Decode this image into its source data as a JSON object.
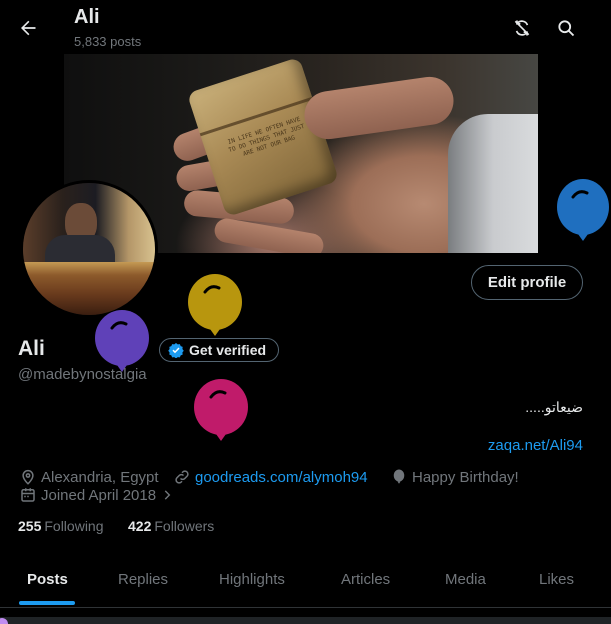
{
  "header": {
    "title": "Ali",
    "post_count": "5,833 posts",
    "back_icon": "arrow-left-icon",
    "actions": [
      "sync-off-icon",
      "search-icon"
    ]
  },
  "banner": {
    "lighter_engraving": "IN LIFE WE OFTEN HAVE TO DO THINGS THAT JUST ARE NOT OUR BAG"
  },
  "profile": {
    "name": "Ali",
    "handle": "@madebynostalgia",
    "verified_label": "Get verified",
    "edit_label": "Edit profile",
    "bio": "ضيعاتو.....",
    "bio_link": "zaqa.net/Ali94",
    "location": "Alexandria, Egypt",
    "website": "goodreads.com/alymoh94",
    "birthday": "Happy Birthday!",
    "joined": "Joined April 2018",
    "following_count": "255",
    "following_label": "Following",
    "followers_count": "422",
    "followers_label": "Followers"
  },
  "balloons": [
    {
      "color": "#1f6fbf"
    },
    {
      "color": "#b8960e"
    },
    {
      "color": "#5f41b8"
    },
    {
      "color": "#c01b6a"
    }
  ],
  "tabs": [
    "Posts",
    "Replies",
    "Highlights",
    "Articles",
    "Media",
    "Likes"
  ],
  "active_tab": "Posts",
  "colors": {
    "accent": "#1d9bf0",
    "background": "#000000",
    "text": "#e7e9ea",
    "muted": "#71767b"
  }
}
